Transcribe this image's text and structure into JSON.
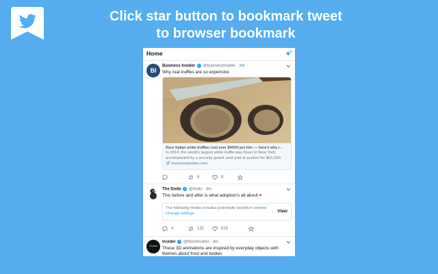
{
  "brand": {
    "accent": "#55acee",
    "link": "#1da1f2",
    "heart": "#e0245e"
  },
  "headline": {
    "line1": "Click star button to bookmark tweet",
    "line2": "to browser bookmark"
  },
  "panel": {
    "title": "Home"
  },
  "tweets": [
    {
      "author": "Business Insider",
      "handle": "@businessinsider",
      "time": "3m",
      "avatar_text": "BI",
      "text": "Why real truffles are so expensive",
      "card": {
        "title": "Rare Italian white truffles cost over $4000 per kilo — here's why r...",
        "description": "In 2014, the world's largest white truffle was flown to New York, accompanied by a security guard, and sold at auction for $61,000.",
        "link": "businessinsider.com"
      },
      "counts": {
        "reply": "",
        "retweet": "6",
        "like": "8"
      }
    },
    {
      "author": "The Dodo",
      "handle": "@dodo",
      "time": "4m",
      "text": "This before and after is what adoption's all about",
      "sensitive": {
        "message": "The following media includes potentially sensitive content.",
        "link": "Change settings",
        "view": "View"
      },
      "counts": {
        "reply": "4",
        "retweet": "132",
        "like": "629"
      }
    },
    {
      "author": "Insider",
      "handle": "@thisisinsider",
      "time": "4m",
      "avatar_text": "INSIDER",
      "text": "These 3D animations are inspired by everyday objects with themes about food and bodies"
    }
  ]
}
